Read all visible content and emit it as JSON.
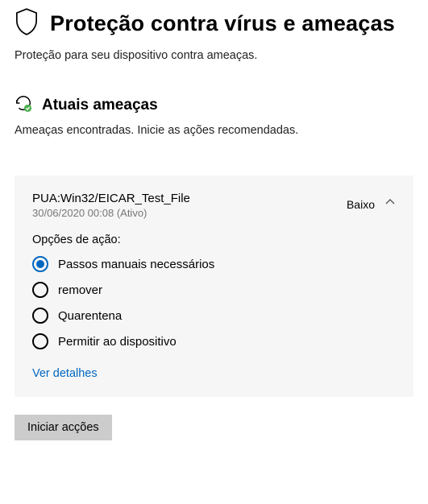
{
  "header": {
    "title": "Proteção contra vírus e ameaças",
    "subtitle": "Proteção para seu dispositivo contra ameaças."
  },
  "section": {
    "title": "Atuais ameaças",
    "desc": "Ameaças encontradas. Inicie as ações recomendadas."
  },
  "threat": {
    "name": "PUA:Win32/EICAR_Test_File",
    "meta": "30/06/2020 00:08 (Ativo)",
    "severity": "Baixo",
    "actions_label": "Opções de ação:",
    "options": {
      "0": "Passos manuais necessários",
      "1": "remover",
      "2": "Quarentena",
      "3": "Permitir ao dispositivo"
    },
    "details_link": "Ver detalhes"
  },
  "start_button": "Iniciar acções"
}
